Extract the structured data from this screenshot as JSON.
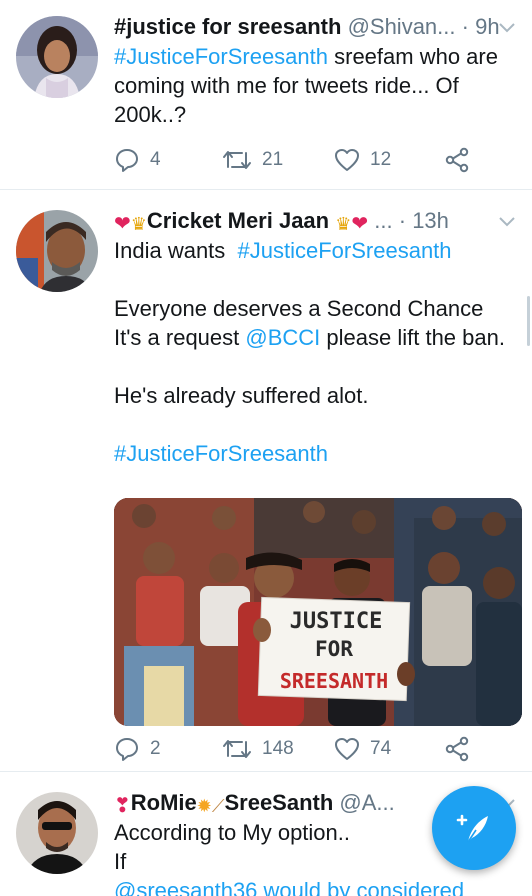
{
  "tweets": [
    {
      "name": "#justice for sreesanth",
      "handle": "@Shivan...",
      "dot": "·",
      "time": "9h",
      "body": {
        "hashtag": "#JusticeForSreesanth",
        "line1_rest": " sreefam who are",
        "line2": "coming with me for tweets ride... Of",
        "line3": "200k..?"
      },
      "replies": "4",
      "retweets": "21",
      "likes": "12"
    },
    {
      "name_prefix_emojis": [
        "heart",
        "crown"
      ],
      "name": "Cricket Meri Jaan",
      "name_suffix_emojis": [
        "crown",
        "heart"
      ],
      "ellipsis": "...",
      "dot": "·",
      "time": "13h",
      "body": {
        "line1_text": "India wants",
        "line1_hashtag": "#JusticeForSreesanth",
        "line3": "Everyone deserves a Second Chance",
        "line4_pre": "It's a request ",
        "line4_mention": "@BCCI",
        "line4_post": " please lift the ban.",
        "line6": "He's already suffered alot.",
        "line8_hashtag": "#JusticeForSreesanth"
      },
      "image": {
        "sign_line1": "JUSTICE",
        "sign_line2": "FOR",
        "sign_line3": "SREESANTH"
      },
      "replies": "2",
      "retweets": "148",
      "likes": "74"
    },
    {
      "name": "RoMie",
      "name_part2": "SreeSanth",
      "handle": "@A...",
      "body": {
        "line1": "According to My option..",
        "line2": "If",
        "line3": "@sreesanth36 would by considered"
      }
    }
  ],
  "colors": {
    "accent": "#1da1f2",
    "secondary_text": "#657786",
    "primary_text": "#14171a",
    "heart": "#e0245e",
    "crown": "#e5a50a"
  },
  "icons": [
    "reply-icon",
    "retweet-icon",
    "like-icon",
    "share-icon",
    "chevron-down-icon",
    "compose-tweet-icon"
  ]
}
